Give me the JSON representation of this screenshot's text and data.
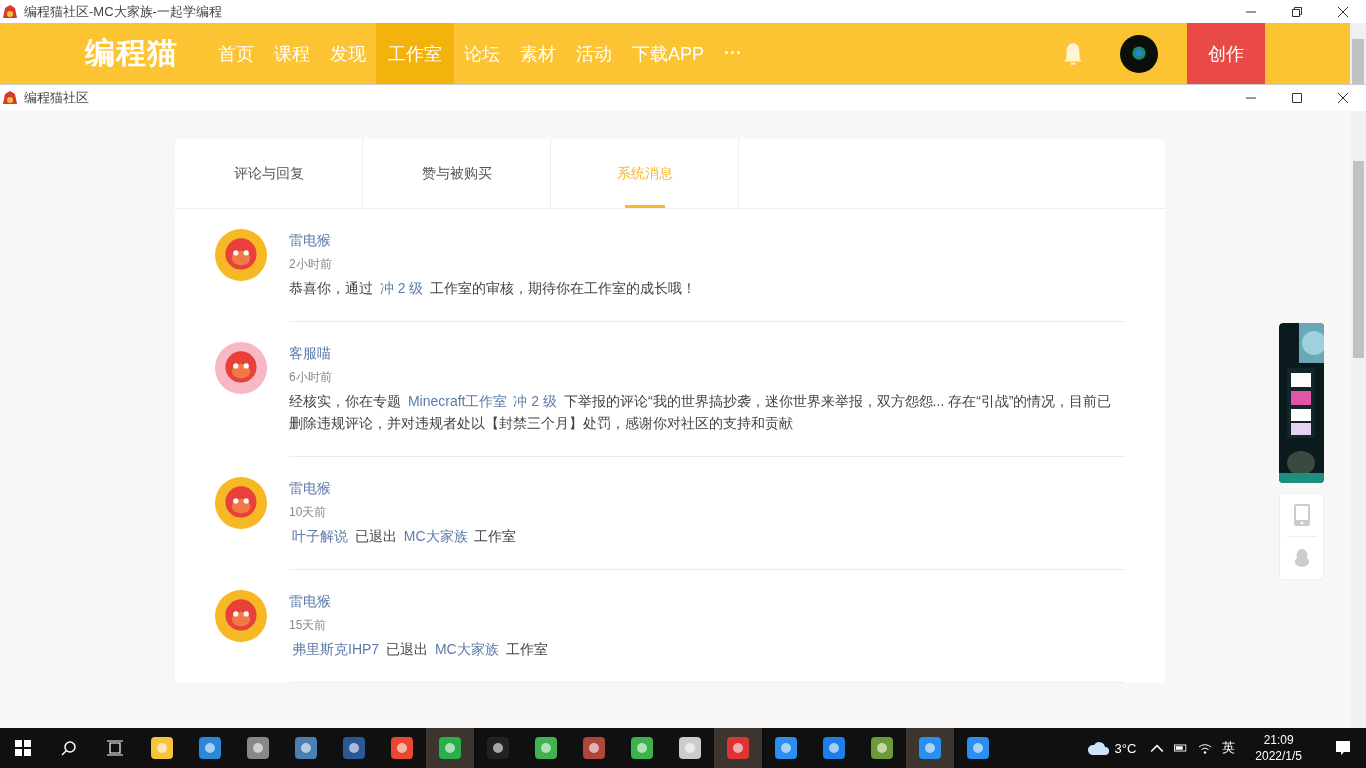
{
  "outer_window": {
    "title": "编程猫社区-MC大家族-一起学编程"
  },
  "navbar": {
    "logo": "编程猫",
    "items": [
      {
        "label": "首页",
        "selected": false
      },
      {
        "label": "课程",
        "selected": false
      },
      {
        "label": "发现",
        "selected": false
      },
      {
        "label": "工作室",
        "selected": true
      },
      {
        "label": "论坛",
        "selected": false
      },
      {
        "label": "素材",
        "selected": false
      },
      {
        "label": "活动",
        "selected": false
      },
      {
        "label": "下载APP",
        "selected": false
      }
    ],
    "more": "···",
    "create_button": "创作"
  },
  "inner_window": {
    "title": "编程猫社区"
  },
  "tabs": [
    {
      "label": "评论与回复",
      "selected": false
    },
    {
      "label": "赞与被购买",
      "selected": false
    },
    {
      "label": "系统消息",
      "selected": true
    }
  ],
  "messages": [
    {
      "color": "#f7b826",
      "sender": "雷电猴",
      "time": "2小时前",
      "parts": [
        {
          "kind": "text",
          "text": "恭喜你，通过 "
        },
        {
          "kind": "link",
          "text": "冲 2 级"
        },
        {
          "kind": "text",
          "text": " 工作室的审核，期待你在工作室的成长哦！"
        }
      ]
    },
    {
      "color": "#f7b7c5",
      "sender": "客服喵",
      "time": "6小时前",
      "parts": [
        {
          "kind": "text",
          "text": "经核实，你在专题 "
        },
        {
          "kind": "link",
          "text": "Minecraft工作室"
        },
        {
          "kind": "link",
          "text": "冲 2 级"
        },
        {
          "kind": "text",
          "text": " 下举报的评论“我的世界搞抄袭，迷你世界来举报，双方怨怨... 存在“引战”的情况，目前已删除违规评论，并对违规者处以【封禁三个月】处罚，感谢你对社区的支持和贡献"
        }
      ]
    },
    {
      "color": "#f7b826",
      "sender": "雷电猴",
      "time": "10天前",
      "parts": [
        {
          "kind": "link",
          "text": "叶子解说"
        },
        {
          "kind": "text",
          "text": " 已退出 "
        },
        {
          "kind": "link",
          "text": "MC大家族"
        },
        {
          "kind": "text",
          "text": " 工作室"
        }
      ]
    },
    {
      "color": "#f7b826",
      "sender": "雷电猴",
      "time": "15天前",
      "parts": [
        {
          "kind": "link",
          "text": "弗里斯克IHP7"
        },
        {
          "kind": "text",
          "text": " 已退出 "
        },
        {
          "kind": "link",
          "text": "MC大家族"
        },
        {
          "kind": "text",
          "text": " 工作室"
        }
      ]
    }
  ],
  "taskbar": {
    "apps": [
      {
        "selected": false
      },
      {
        "selected": false
      },
      {
        "selected": false
      },
      {
        "selected": false
      },
      {
        "selected": false
      },
      {
        "selected": false
      },
      {
        "selected": true
      },
      {
        "selected": false
      },
      {
        "selected": false
      },
      {
        "selected": false
      },
      {
        "selected": false
      },
      {
        "selected": false
      },
      {
        "selected": true
      },
      {
        "selected": false
      },
      {
        "selected": false
      },
      {
        "selected": false
      },
      {
        "selected": true
      },
      {
        "selected": false
      }
    ],
    "weather": "3°C",
    "ime": "英",
    "time": "21:09",
    "date": "2022/1/5"
  }
}
